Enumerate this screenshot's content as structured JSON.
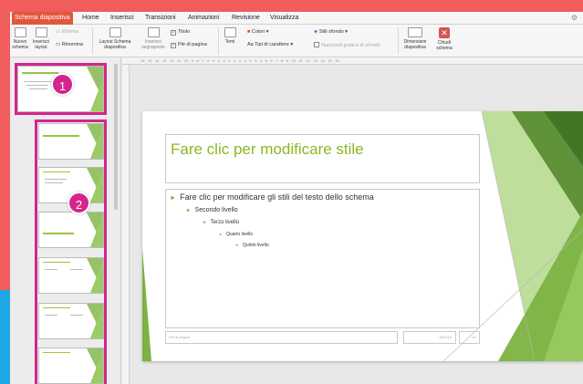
{
  "ribbon": {
    "tabs": [
      "Schema diapositiva",
      "Home",
      "Inserisci",
      "Transizioni",
      "Animazioni",
      "Revisione",
      "Visualizza"
    ],
    "new_master": "Nuovo schema",
    "insert_layout": "Inserisci layout",
    "delete": "Elimina",
    "rename": "Rinomina",
    "master_layout": "Layout Schema diapositiva",
    "insert_placeholder": "Inserisci segnaposto",
    "title_check": "Titolo",
    "footer_check": "Piè di pagina",
    "themes": "Temi",
    "colors": "Colori",
    "fonts": "Tipi di carattere",
    "background_styles": "Stili sfondo",
    "hide_background": "Nascondi grafica di sfondo",
    "slide_size": "Dimensioni diapositiva",
    "close_master": "Chiudi schema"
  },
  "ruler_text": "16 · 15 · 14 · 13 · 12 · 11 · 10 · 9 · 8 · 7 · 6 · 5 · 4 · 3 · 2 · 1 · 0 · 1 · 2 · 3 · 4 · 5 · 6 · 7 · 8 · 9 · 10 · 11 · 12 · 13 · 14 · 15 · 16",
  "badges": [
    "1",
    "2"
  ],
  "slide": {
    "title": "Fare clic per modificare stile",
    "levels": [
      "Fare clic per modificare gli stili del testo dello schema",
      "Secondo livello",
      "Terzo livello",
      "Quarto livello",
      "Quinto livello"
    ],
    "footer": "Piè di pagina",
    "date": "0/00/15",
    "number": "‹#›"
  },
  "colors": {
    "accent_pink": "#d4258c",
    "theme_green": "#8ab823",
    "tab_active": "#e1573e"
  }
}
